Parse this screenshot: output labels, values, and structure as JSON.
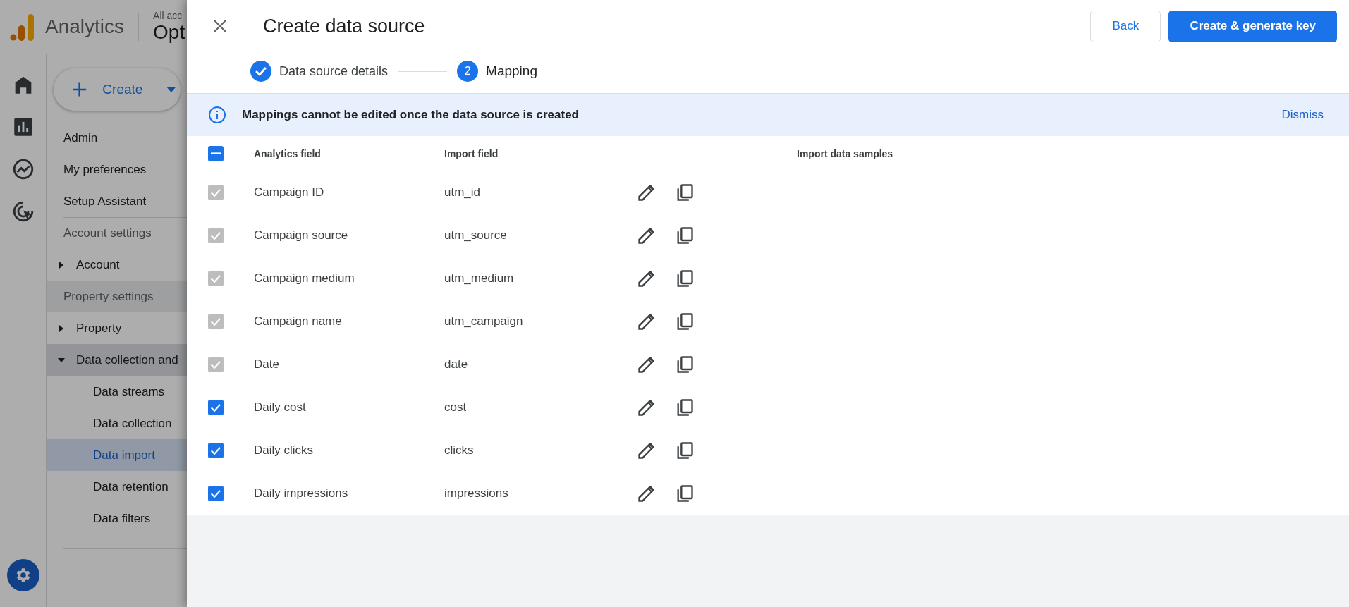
{
  "app_header": {
    "product": "Analytics",
    "account_label": "All acc",
    "property_name": "Opt"
  },
  "nav": {
    "create_button": {
      "label": "Create"
    },
    "items": [
      {
        "kind": "link",
        "label": "Admin"
      },
      {
        "kind": "link",
        "label": "My preferences"
      },
      {
        "kind": "link",
        "label": "Setup Assistant"
      },
      {
        "kind": "section",
        "label": "Account settings"
      },
      {
        "kind": "group",
        "label": "Account",
        "expanded": false
      },
      {
        "kind": "section",
        "label": "Property settings"
      },
      {
        "kind": "group",
        "label": "Property",
        "expanded": false
      },
      {
        "kind": "group",
        "label": "Data collection and",
        "expanded": true,
        "children": [
          {
            "label": "Data streams",
            "selected": false
          },
          {
            "label": "Data collection",
            "selected": false
          },
          {
            "label": "Data import",
            "selected": true
          },
          {
            "label": "Data retention",
            "selected": false
          },
          {
            "label": "Data filters",
            "selected": false
          }
        ]
      }
    ]
  },
  "dialog": {
    "title": "Create data source",
    "back_button": "Back",
    "primary_button": "Create & generate key",
    "steps": [
      {
        "completed": true,
        "selected": false,
        "label": "Data source details"
      },
      {
        "completed": false,
        "selected": true,
        "number": "2",
        "label": "Mapping"
      }
    ],
    "banner": {
      "message": "Mappings cannot be edited once the data source is created",
      "action": "Dismiss"
    },
    "table": {
      "select_all": {
        "indeterminate": true
      },
      "columns": [
        "Analytics field",
        "Import field",
        "Import data samples"
      ],
      "rows": [
        {
          "analytics_field": "Campaign ID",
          "import_field": "utm_id",
          "checked": true,
          "disabled": true
        },
        {
          "analytics_field": "Campaign source",
          "import_field": "utm_source",
          "checked": true,
          "disabled": true
        },
        {
          "analytics_field": "Campaign medium",
          "import_field": "utm_medium",
          "checked": true,
          "disabled": true
        },
        {
          "analytics_field": "Campaign name",
          "import_field": "utm_campaign",
          "checked": true,
          "disabled": true
        },
        {
          "analytics_field": "Date",
          "import_field": "date",
          "checked": true,
          "disabled": true
        },
        {
          "analytics_field": "Daily cost",
          "import_field": "cost",
          "checked": true,
          "disabled": false
        },
        {
          "analytics_field": "Daily clicks",
          "import_field": "clicks",
          "checked": true,
          "disabled": false
        },
        {
          "analytics_field": "Daily impressions",
          "import_field": "impressions",
          "checked": true,
          "disabled": false
        }
      ]
    }
  }
}
